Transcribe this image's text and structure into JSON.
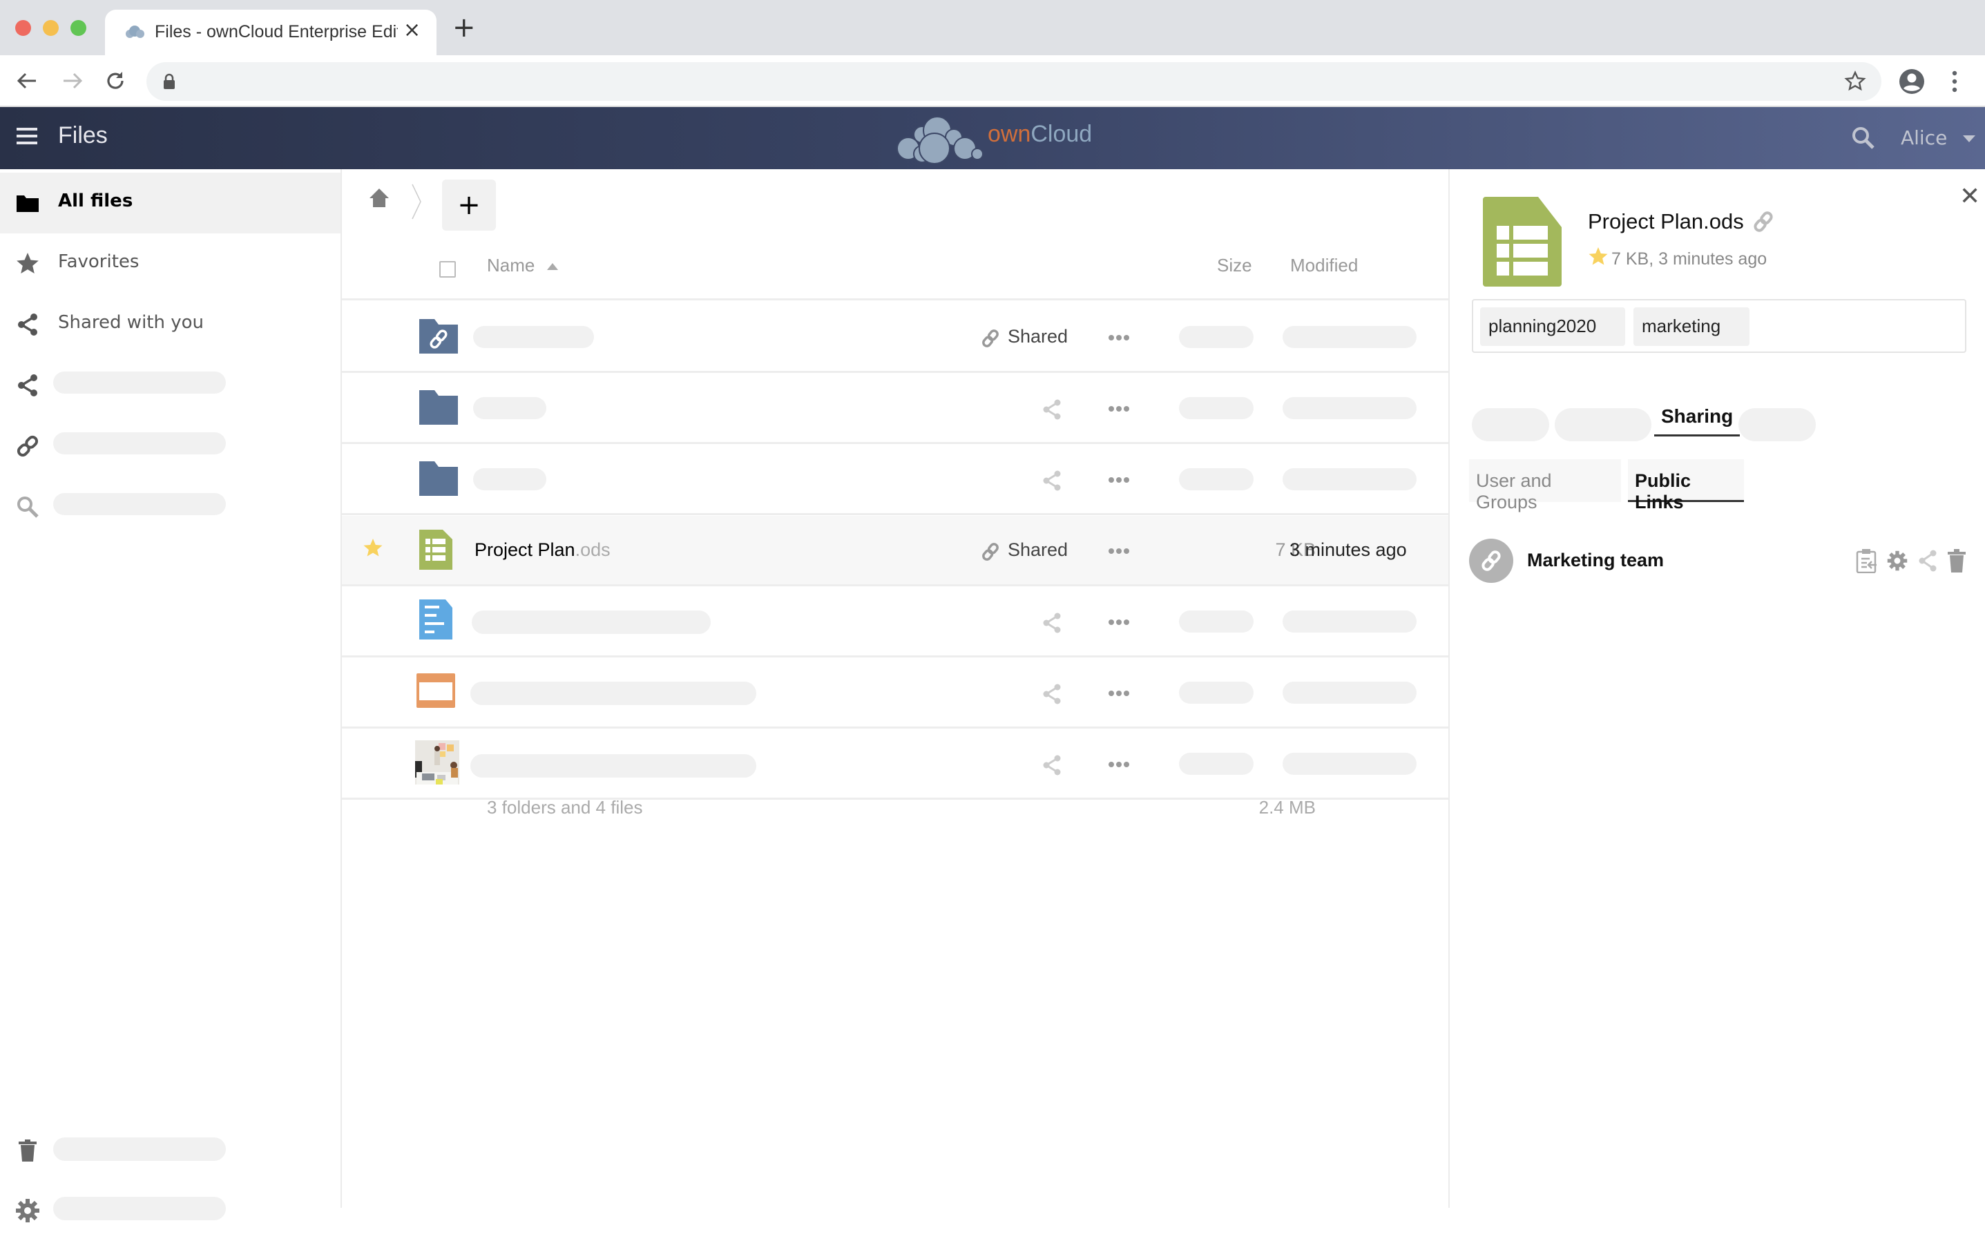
{
  "browser": {
    "tab_title": "Files - ownCloud Enterprise Edition",
    "new_tab_label": "+",
    "close_tab_label": "×"
  },
  "app": {
    "title": "Files",
    "logo_own": "own",
    "logo_cloud": "Cloud",
    "user": "Alice",
    "colors": {
      "header_dark": "#293148",
      "header_light": "#5a6790",
      "logo_orange": "#d16f3b",
      "logo_blue": "#8fa8c0",
      "folder": "#5b7395",
      "spreadsheet": "#a3b85c",
      "document": "#5fa9e2",
      "presentation": "#e79a63",
      "favorite_star": "#f8d25e"
    }
  },
  "sidebar": {
    "items": [
      {
        "label": "All files",
        "icon": "folder-icon",
        "active": true
      },
      {
        "label": "Favorites",
        "icon": "star-icon",
        "active": false
      },
      {
        "label": "Shared with you",
        "icon": "share-icon",
        "active": false
      },
      {
        "label": "",
        "icon": "share-icon",
        "placeholder": true
      },
      {
        "label": "",
        "icon": "link-icon",
        "placeholder": true
      },
      {
        "label": "",
        "icon": "search-icon",
        "placeholder": true
      }
    ],
    "footer": [
      {
        "label": "",
        "icon": "trash-icon",
        "placeholder": true
      },
      {
        "label": "",
        "icon": "gear-icon",
        "placeholder": true
      }
    ]
  },
  "filelist": {
    "add_label": "+",
    "columns": {
      "name": "Name",
      "size": "Size",
      "modified": "Modified"
    },
    "rows": [
      {
        "type": "folder-link",
        "name": "",
        "ext": "",
        "shared_label": "Shared",
        "shared": true,
        "favorite": false,
        "size": "",
        "modified": ""
      },
      {
        "type": "folder",
        "name": "",
        "ext": "",
        "shared_label": "",
        "shared": false,
        "favorite": false,
        "size": "",
        "modified": ""
      },
      {
        "type": "folder",
        "name": "",
        "ext": "",
        "shared_label": "",
        "shared": false,
        "favorite": false,
        "size": "",
        "modified": ""
      },
      {
        "type": "spreadsheet",
        "name": "Project Plan",
        "ext": ".ods",
        "shared_label": "Shared",
        "shared": true,
        "favorite": true,
        "size": "7 KB",
        "modified": "3 minutes ago"
      },
      {
        "type": "document",
        "name": "",
        "ext": "",
        "shared_label": "",
        "shared": false,
        "favorite": false,
        "size": "",
        "modified": ""
      },
      {
        "type": "presentation",
        "name": "",
        "ext": "",
        "shared_label": "",
        "shared": false,
        "favorite": false,
        "size": "",
        "modified": ""
      },
      {
        "type": "image",
        "name": "",
        "ext": "",
        "shared_label": "",
        "shared": false,
        "favorite": false,
        "size": "",
        "modified": ""
      }
    ],
    "summary": {
      "count": "3 folders and 4 files",
      "total_size": "2.4 MB"
    }
  },
  "details": {
    "filename": "Project Plan.ods",
    "meta": "7 KB, 3 minutes ago",
    "tags": [
      "planning2020",
      "marketing"
    ],
    "tabs": {
      "active": "Sharing"
    },
    "subtabs": [
      "User and Groups",
      "Public Links"
    ],
    "active_subtab": "Public Links",
    "public_links": [
      {
        "name": "Marketing team"
      }
    ]
  }
}
